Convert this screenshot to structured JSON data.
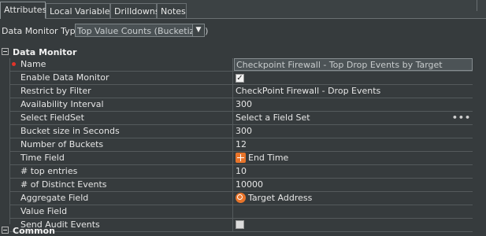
{
  "tabs": [
    {
      "label": "Attributes",
      "active": true
    },
    {
      "label": "Local Variables",
      "active": false
    },
    {
      "label": "Drilldowns",
      "active": false
    },
    {
      "label": "Notes",
      "active": false
    }
  ],
  "data_monitor_type": {
    "label": "Data Monitor Type",
    "selected": "Top Value Counts (Bucketized)"
  },
  "section": {
    "title": "Data Monitor",
    "expanded": true
  },
  "properties": [
    {
      "name": "Name",
      "value": "Checkpoint Firewall - Top Drop Events by Target",
      "required": true
    },
    {
      "name": "Enable Data Monitor",
      "value": "",
      "checkbox": true,
      "checked": true
    },
    {
      "name": "Restrict by Filter",
      "value": "CheckPoint Firewall - Drop Events"
    },
    {
      "name": "Availability Interval",
      "value": "300"
    },
    {
      "name": "Select FieldSet",
      "value": "Select a Field Set",
      "browse": "•••"
    },
    {
      "name": "Bucket size in Seconds",
      "value": "300"
    },
    {
      "name": "Number of Buckets",
      "value": "12"
    },
    {
      "name": "Time Field",
      "value": "End Time",
      "icon": "time-field-icon"
    },
    {
      "name": "# top entries",
      "value": "10"
    },
    {
      "name": "# of Distinct Events",
      "value": "10000"
    },
    {
      "name": "Aggregate Field",
      "value": "Target Address",
      "icon": "target-address-icon"
    },
    {
      "name": "Value Field",
      "value": ""
    },
    {
      "name": "Send Audit Events",
      "value": "",
      "checkbox": true,
      "checked": false
    }
  ],
  "common_section": {
    "title": "Common",
    "expanded": true
  }
}
